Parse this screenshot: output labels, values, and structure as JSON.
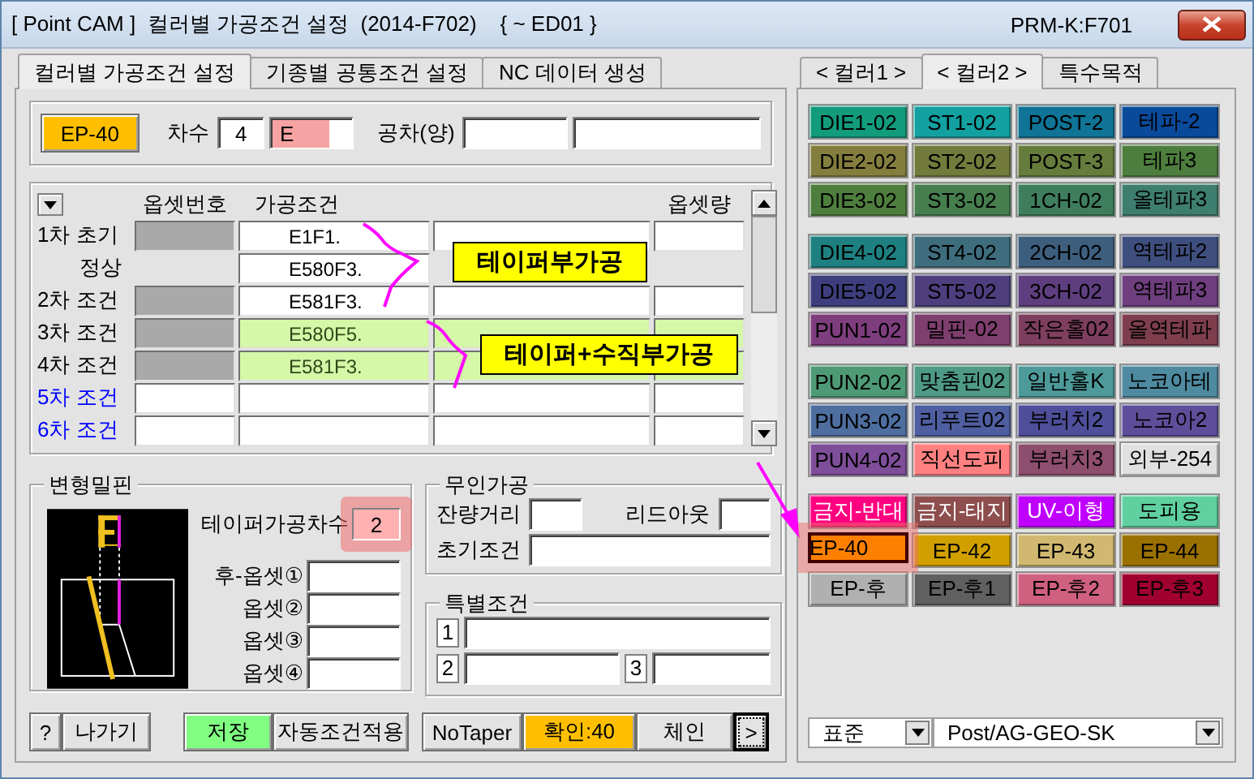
{
  "window": {
    "title": "[ Point CAM ]  컬러별 가공조건 설정  (2014-F702)    { ~ ED01 }",
    "code": "PRM-K:F701"
  },
  "tabs": [
    {
      "label": "컬러별 가공조건 설정",
      "selected": true
    },
    {
      "label": "기종별 공통조건 설정",
      "selected": false
    },
    {
      "label": "NC 데이터 생성",
      "selected": false
    }
  ],
  "header": {
    "color_button": "EP-40",
    "order_label": "차수",
    "order": "4",
    "order_code": {
      "value": "E",
      "highlighted": true
    },
    "tolerance_label": "공차(양)"
  },
  "grid": {
    "columns": [
      "옵셋번호",
      "가공조건",
      "옵셋량"
    ],
    "rows": [
      {
        "label": "1차 초기",
        "kind": "used",
        "condition": "E1F1.",
        "highlighted": false
      },
      {
        "label": "정상",
        "kind": "sub",
        "condition": "E580F3.",
        "highlighted": false
      },
      {
        "label": "2차 조건",
        "kind": "used",
        "condition": "E581F3.",
        "highlighted": false
      },
      {
        "label": "3차 조건",
        "kind": "used",
        "condition": "E580F5.",
        "highlighted": true
      },
      {
        "label": "4차 조건",
        "kind": "used",
        "condition": "E581F3.",
        "highlighted": true
      },
      {
        "label": "5차 조건",
        "kind": "empty",
        "condition": "",
        "highlighted": false
      },
      {
        "label": "6차 조건",
        "kind": "empty",
        "condition": "",
        "highlighted": false
      }
    ]
  },
  "annotations": [
    {
      "text": "테이퍼부가공"
    },
    {
      "text": "테이퍼+수직부가공"
    }
  ],
  "pin": {
    "title": "변형밀핀",
    "taper_label": "테이퍼가공차수",
    "taper": {
      "value": "2",
      "highlighted": true
    },
    "offsets": [
      "후-옵셋①",
      "옵셋②",
      "옵셋③",
      "옵셋④"
    ]
  },
  "unmanned": {
    "title": "무인가공",
    "labels": [
      "잔량거리",
      "리드아웃",
      "초기조건"
    ]
  },
  "special": {
    "title": "특별조건",
    "slots": [
      "1",
      "2",
      "3"
    ]
  },
  "button_groups": [
    [
      {
        "label": "?",
        "kind": "plain"
      },
      {
        "label": "나가기",
        "kind": "plain"
      }
    ],
    [
      {
        "label": "저장",
        "kind": "save"
      },
      {
        "label": "자동조건적용",
        "kind": "plain"
      }
    ],
    [
      {
        "label": "NoTaper",
        "kind": "plain"
      },
      {
        "label": "확인:40",
        "kind": "confirm"
      },
      {
        "label": "체인",
        "kind": "plain"
      },
      {
        "label": ">",
        "kind": "focus"
      }
    ]
  ],
  "color_tabs": [
    {
      "label": "< 컬러1 >",
      "selected": false
    },
    {
      "label": "< 컬러2 >",
      "selected": true
    },
    {
      "label": "특수목적",
      "selected": false
    }
  ],
  "color_groups": [
    [
      {
        "label": "DIE1-02",
        "color": "#129c7c",
        "light_text": false,
        "selected": false
      },
      {
        "label": "ST1-02",
        "color": "#13a0a0",
        "light_text": false,
        "selected": false
      },
      {
        "label": "POST-2",
        "color": "#0f7496",
        "light_text": false,
        "selected": false
      },
      {
        "label": "테파-2",
        "color": "#0a4a9a",
        "light_text": false,
        "selected": false
      },
      {
        "label": "DIE2-02",
        "color": "#847e3e",
        "light_text": false,
        "selected": false
      },
      {
        "label": "ST2-02",
        "color": "#727a3c",
        "light_text": false,
        "selected": false
      },
      {
        "label": "POST-3",
        "color": "#667c3c",
        "light_text": false,
        "selected": false
      },
      {
        "label": "테파3",
        "color": "#4e7e3e",
        "light_text": false,
        "selected": false
      },
      {
        "label": "DIE3-02",
        "color": "#4e7e3e",
        "light_text": false,
        "selected": false
      },
      {
        "label": "ST3-02",
        "color": "#467e4e",
        "light_text": false,
        "selected": false
      },
      {
        "label": "1CH-02",
        "color": "#3e7e5e",
        "light_text": false,
        "selected": false
      },
      {
        "label": "올테파3",
        "color": "#3e7e6e",
        "light_text": false,
        "selected": false
      }
    ],
    [
      {
        "label": "DIE4-02",
        "color": "#1e8080",
        "light_text": false,
        "selected": false
      },
      {
        "label": "ST4-02",
        "color": "#3e6e7e",
        "light_text": false,
        "selected": false
      },
      {
        "label": "2CH-02",
        "color": "#3e5e7e",
        "light_text": false,
        "selected": false
      },
      {
        "label": "역테파2",
        "color": "#3e4e7e",
        "light_text": false,
        "selected": false
      },
      {
        "label": "DIE5-02",
        "color": "#3e3e7e",
        "light_text": false,
        "selected": false
      },
      {
        "label": "ST5-02",
        "color": "#4e3e7e",
        "light_text": false,
        "selected": false
      },
      {
        "label": "3CH-02",
        "color": "#5e3e7e",
        "light_text": false,
        "selected": false
      },
      {
        "label": "역테파3",
        "color": "#6e3e7e",
        "light_text": false,
        "selected": false
      },
      {
        "label": "PUN1-02",
        "color": "#7e3e7e",
        "light_text": false,
        "selected": false
      },
      {
        "label": "밀핀-02",
        "color": "#7e3e6e",
        "light_text": false,
        "selected": false
      },
      {
        "label": "작은홀02",
        "color": "#7e3e5e",
        "light_text": false,
        "selected": false
      },
      {
        "label": "올역테파",
        "color": "#7e3e4e",
        "light_text": false,
        "selected": false
      }
    ],
    [
      {
        "label": "PUN2-02",
        "color": "#4e9a76",
        "light_text": false,
        "selected": false
      },
      {
        "label": "맞춤핀02",
        "color": "#4e9a86",
        "light_text": false,
        "selected": false
      },
      {
        "label": "일반홀K",
        "color": "#4e9a9a",
        "light_text": false,
        "selected": false
      },
      {
        "label": "노코아테",
        "color": "#4e8aa0",
        "light_text": false,
        "selected": false
      },
      {
        "label": "PUN3-02",
        "color": "#4e6ea0",
        "light_text": false,
        "selected": false
      },
      {
        "label": "리푸트02",
        "color": "#4e5ea0",
        "light_text": false,
        "selected": false
      },
      {
        "label": "부러치2",
        "color": "#4e4e9a",
        "light_text": false,
        "selected": false
      },
      {
        "label": "노코아2",
        "color": "#5e4e9a",
        "light_text": false,
        "selected": false
      },
      {
        "label": "PUN4-02",
        "color": "#7e4e9a",
        "light_text": false,
        "selected": false
      },
      {
        "label": "직선도피",
        "color": "#ff8080",
        "light_text": false,
        "selected": false
      },
      {
        "label": "부러치3",
        "color": "#8e4e6e",
        "light_text": false,
        "selected": false
      },
      {
        "label": "외부-254",
        "color": "#e0e0e0",
        "light_text": false,
        "selected": false
      }
    ],
    [
      {
        "label": "금지-반대",
        "color": "#ff0080",
        "light_text": true,
        "selected": false
      },
      {
        "label": "금지-태지",
        "color": "#8e4e4e",
        "light_text": true,
        "selected": false
      },
      {
        "label": "UV-이형",
        "color": "#c000ff",
        "light_text": true,
        "selected": false
      },
      {
        "label": "도피용",
        "color": "#60d0a0",
        "light_text": false,
        "selected": false
      },
      {
        "label": "EP-40",
        "color": "#ff8000",
        "light_text": false,
        "selected": true
      },
      {
        "label": "EP-42",
        "color": "#d0a000",
        "light_text": false,
        "selected": false
      },
      {
        "label": "EP-43",
        "color": "#d0b870",
        "light_text": false,
        "selected": false
      },
      {
        "label": "EP-44",
        "color": "#9a7000",
        "light_text": false,
        "selected": false
      },
      {
        "label": "EP-후",
        "color": "#b0b0b0",
        "light_text": false,
        "selected": false
      },
      {
        "label": "EP-후1",
        "color": "#606060",
        "light_text": false,
        "selected": false
      },
      {
        "label": "EP-후2",
        "color": "#d06080",
        "light_text": false,
        "selected": false
      },
      {
        "label": "EP-후3",
        "color": "#a00030",
        "light_text": false,
        "selected": false
      }
    ]
  ],
  "selects": [
    {
      "value": "표준"
    },
    {
      "value": "Post/AG-GEO-SK"
    }
  ]
}
